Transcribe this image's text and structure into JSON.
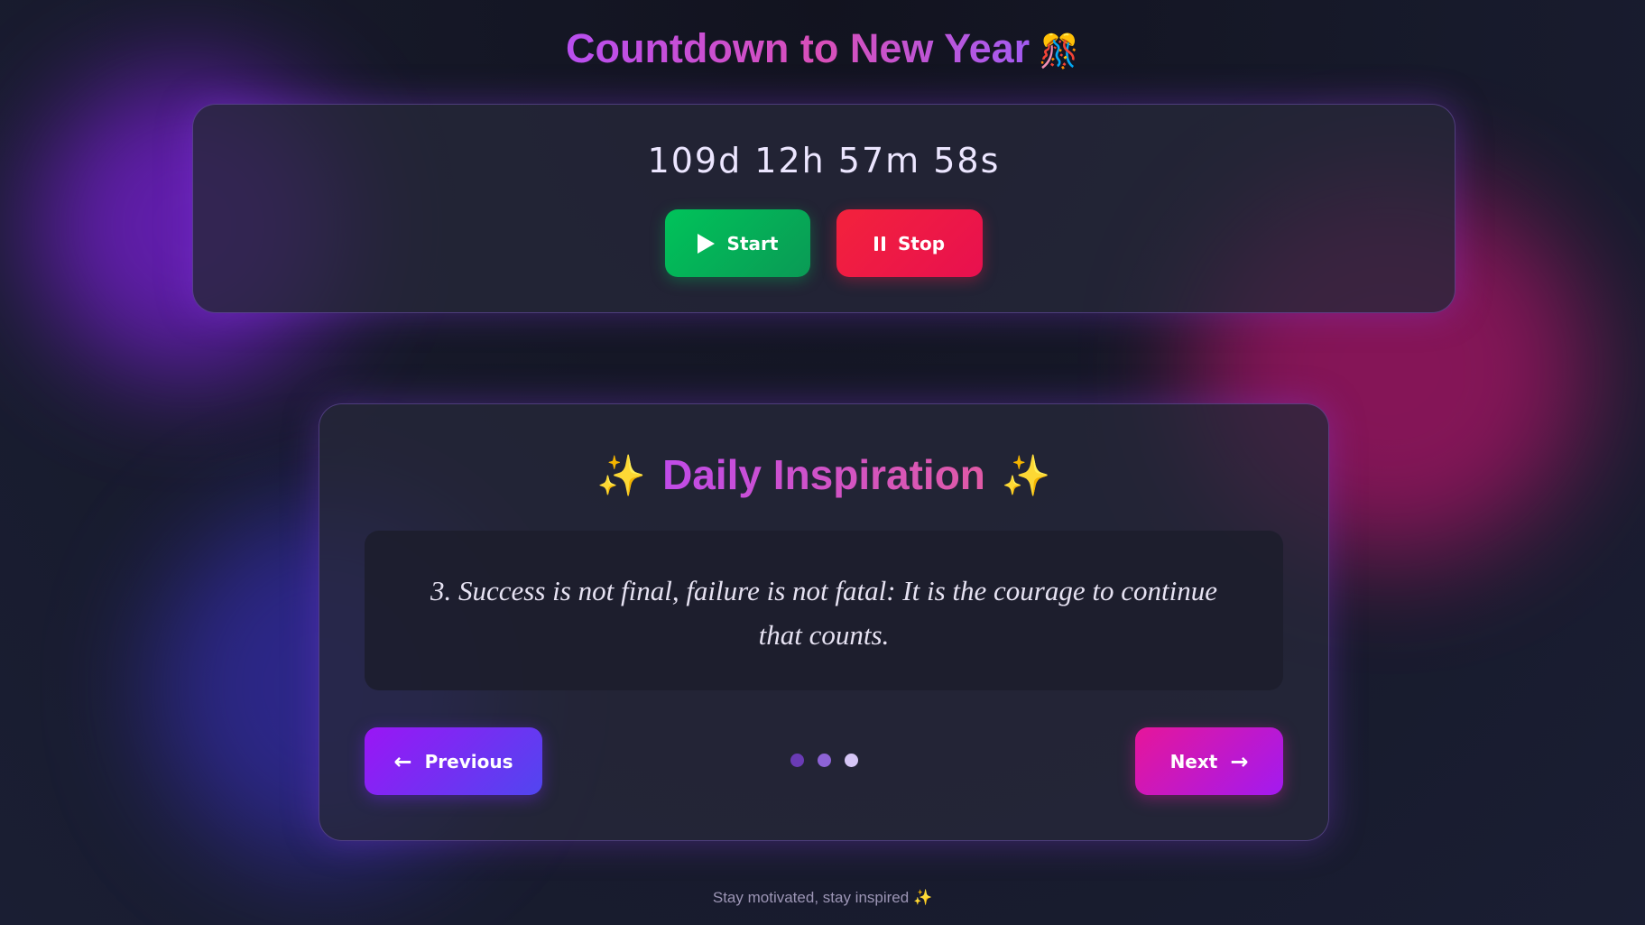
{
  "header": {
    "title": "Countdown to New Year",
    "title_emoji": "🎊"
  },
  "timer": {
    "display": "109d 12h 57m 58s",
    "start_label": "Start",
    "stop_label": "Stop"
  },
  "quote_section": {
    "sparkle_left": "✨",
    "heading": "Daily Inspiration",
    "sparkle_right": "✨",
    "quote": "3. Success is not final, failure is not fatal: It is the courage to continue that counts.",
    "prev_label": "Previous",
    "next_label": "Next",
    "page_dots": 3,
    "active_dot": 3
  },
  "footer": {
    "text": "Stay motivated, stay inspired",
    "emoji": "✨"
  },
  "colors": {
    "accent_purple": "#9a16f5",
    "accent_pink": "#e6169a",
    "start_green": "#00c35a",
    "stop_red": "#f3223c",
    "background": "#161827"
  },
  "icons": [
    "play-icon",
    "pause-icon",
    "arrow-left-icon",
    "arrow-right-icon",
    "sparkle-icon",
    "party-icon"
  ]
}
